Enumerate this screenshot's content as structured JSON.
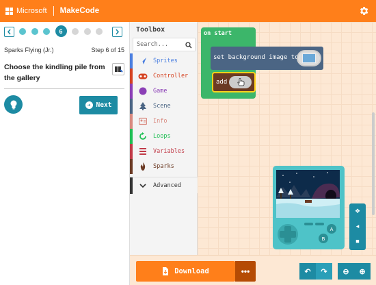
{
  "header": {
    "brand": "Microsoft",
    "product": "MakeCode"
  },
  "tutorial": {
    "current_step": "6",
    "title": "Sparks Flying (Jr.)",
    "step_text": "Step 6 of 15",
    "instruction": "Choose the kindling pile from the gallery",
    "next_label": "Next"
  },
  "toolbox": {
    "title": "Toolbox",
    "search_placeholder": "Search...",
    "categories": [
      {
        "label": "Sprites",
        "color": "#4b7fe0"
      },
      {
        "label": "Controller",
        "color": "#d54322"
      },
      {
        "label": "Game",
        "color": "#8b3fb6"
      },
      {
        "label": "Scene",
        "color": "#4b6584"
      },
      {
        "label": "Info",
        "color": "#d98a80"
      },
      {
        "label": "Loops",
        "color": "#20bf55"
      },
      {
        "label": "Variables",
        "color": "#c13b48"
      },
      {
        "label": "Sparks",
        "color": "#6b3a24"
      }
    ],
    "advanced_label": "Advanced"
  },
  "workspace": {
    "on_start_label": "on start",
    "set_bg_label": "set background image to",
    "add_label": "add"
  },
  "bottom": {
    "download_label": "Download",
    "more_label": "•••"
  }
}
